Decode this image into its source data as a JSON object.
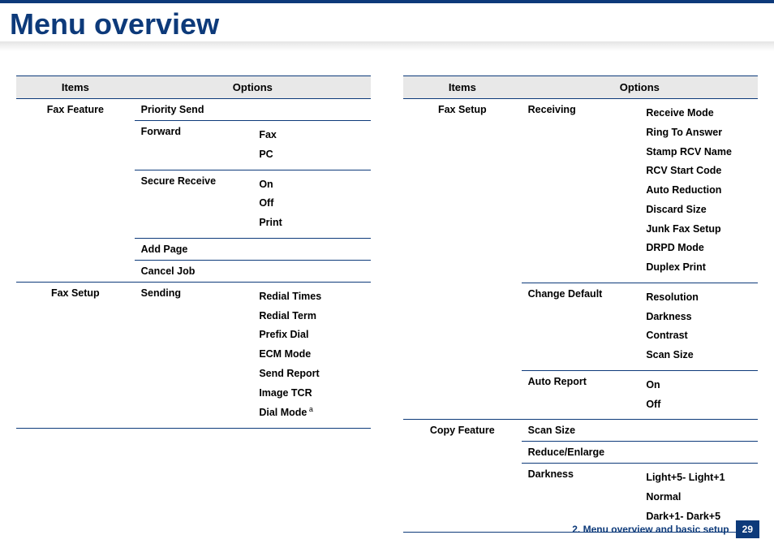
{
  "title": "Menu overview",
  "headers": {
    "items": "Items",
    "options": "Options"
  },
  "left": {
    "rows": [
      {
        "item": "Fax Feature",
        "opt1": "Priority Send",
        "opt2": null,
        "span": 2
      },
      {
        "item": null,
        "opt1": "Forward",
        "opt2": [
          "Fax",
          "PC"
        ]
      },
      {
        "item": null,
        "opt1": "Secure Receive",
        "opt2": [
          "On",
          "Off",
          "Print"
        ]
      },
      {
        "item": null,
        "opt1": "Add Page",
        "opt2": null,
        "span": 2
      },
      {
        "item": null,
        "opt1": "Cancel Job",
        "opt2": null,
        "span": 2
      },
      {
        "item": "Fax Setup",
        "opt1": "Sending",
        "opt2": [
          "Redial Times",
          "Redial Term",
          "Prefix Dial",
          "ECM Mode",
          "Send Report",
          "Image TCR",
          "Dial Mode"
        ],
        "sup": "a",
        "last": true
      }
    ]
  },
  "right": {
    "rows": [
      {
        "item": "Fax Setup",
        "opt1": "Receiving",
        "opt2": [
          "Receive Mode",
          "Ring To Answer",
          "Stamp RCV Name",
          "RCV Start Code",
          "Auto Reduction",
          "Discard Size",
          "Junk Fax Setup",
          "DRPD Mode",
          "Duplex Print"
        ]
      },
      {
        "item": null,
        "opt1": "Change Default",
        "opt2": [
          "Resolution",
          "Darkness",
          "Contrast",
          "Scan Size"
        ]
      },
      {
        "item": null,
        "opt1": "Auto Report",
        "opt2": [
          "On",
          "Off"
        ]
      },
      {
        "item": "Copy Feature",
        "opt1": "Scan Size",
        "opt2": null,
        "span": 2
      },
      {
        "item": null,
        "opt1": "Reduce/Enlarge",
        "opt2": null,
        "span": 2
      },
      {
        "item": null,
        "opt1": "Darkness",
        "opt2": [
          "Light+5- Light+1",
          "Normal",
          "Dark+1- Dark+5"
        ],
        "last": true
      }
    ]
  },
  "footer": {
    "section": "2. Menu overview and basic setup",
    "page": "29"
  }
}
